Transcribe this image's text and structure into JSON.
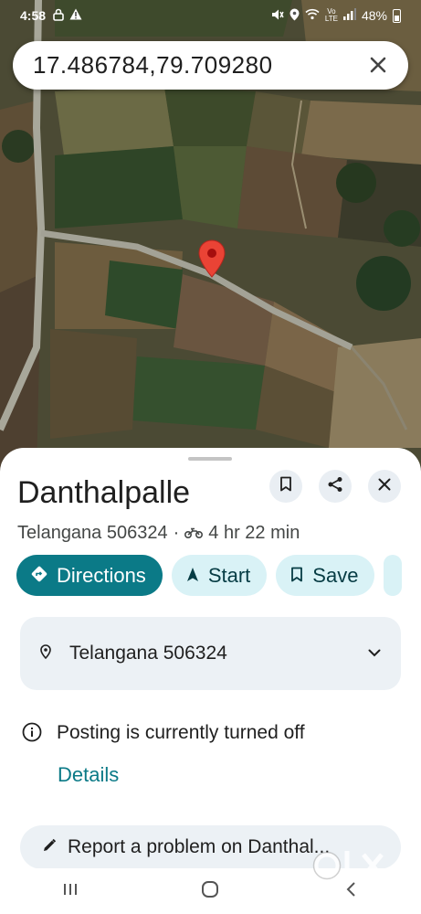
{
  "status_bar": {
    "time": "4:58",
    "battery": "48%",
    "left_icons": [
      "lock-icon",
      "alert-icon"
    ],
    "right_icons": [
      "mute-icon",
      "location-icon",
      "wifi-icon",
      "volte-icon",
      "signal-icon",
      "battery-icon"
    ]
  },
  "search": {
    "query": "17.486784,79.709280",
    "close_icon": "close-icon"
  },
  "place": {
    "name": "Danthalpalle",
    "region": "Telangana 506324",
    "separator": "·",
    "travel_time": "4 hr 22 min",
    "travel_mode_icon": "motorcycle-icon"
  },
  "header_actions": {
    "save_icon": "bookmark-icon",
    "share_icon": "share-icon",
    "close_icon": "close-icon"
  },
  "chips": {
    "directions": "Directions",
    "start": "Start",
    "save": "Save"
  },
  "address_card": {
    "text": "Telangana 506324"
  },
  "notice": {
    "text": "Posting is currently turned off",
    "link": "Details"
  },
  "report": {
    "label": "Report a problem on Danthal..."
  },
  "colors": {
    "accent": "#0b7a87",
    "chip_secondary": "#d9f2f6",
    "card_bg": "#ecf1f5",
    "pin": "#ea4335"
  },
  "watermark": {
    "brand": "OLX"
  }
}
